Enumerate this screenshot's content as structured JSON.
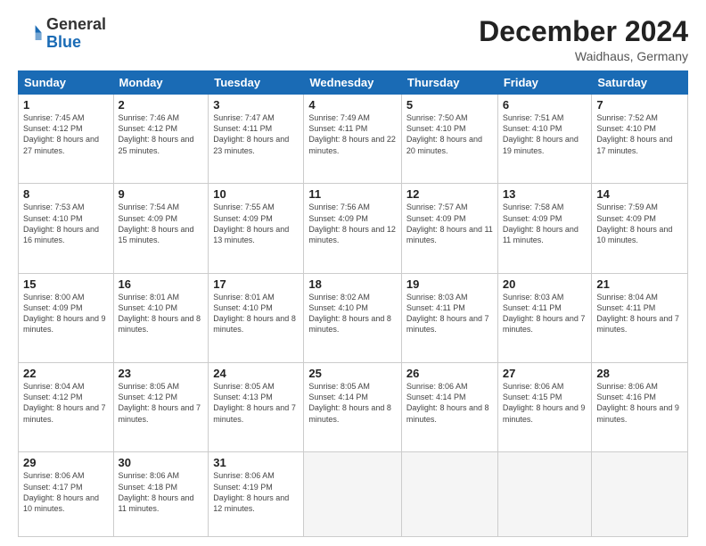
{
  "header": {
    "logo_text_general": "General",
    "logo_text_blue": "Blue",
    "month_title": "December 2024",
    "location": "Waidhaus, Germany"
  },
  "days_of_week": [
    "Sunday",
    "Monday",
    "Tuesday",
    "Wednesday",
    "Thursday",
    "Friday",
    "Saturday"
  ],
  "weeks": [
    [
      {
        "day": "1",
        "sunrise": "7:45 AM",
        "sunset": "4:12 PM",
        "daylight": "8 hours and 27 minutes."
      },
      {
        "day": "2",
        "sunrise": "7:46 AM",
        "sunset": "4:12 PM",
        "daylight": "8 hours and 25 minutes."
      },
      {
        "day": "3",
        "sunrise": "7:47 AM",
        "sunset": "4:11 PM",
        "daylight": "8 hours and 23 minutes."
      },
      {
        "day": "4",
        "sunrise": "7:49 AM",
        "sunset": "4:11 PM",
        "daylight": "8 hours and 22 minutes."
      },
      {
        "day": "5",
        "sunrise": "7:50 AM",
        "sunset": "4:10 PM",
        "daylight": "8 hours and 20 minutes."
      },
      {
        "day": "6",
        "sunrise": "7:51 AM",
        "sunset": "4:10 PM",
        "daylight": "8 hours and 19 minutes."
      },
      {
        "day": "7",
        "sunrise": "7:52 AM",
        "sunset": "4:10 PM",
        "daylight": "8 hours and 17 minutes."
      }
    ],
    [
      {
        "day": "8",
        "sunrise": "7:53 AM",
        "sunset": "4:10 PM",
        "daylight": "8 hours and 16 minutes."
      },
      {
        "day": "9",
        "sunrise": "7:54 AM",
        "sunset": "4:09 PM",
        "daylight": "8 hours and 15 minutes."
      },
      {
        "day": "10",
        "sunrise": "7:55 AM",
        "sunset": "4:09 PM",
        "daylight": "8 hours and 13 minutes."
      },
      {
        "day": "11",
        "sunrise": "7:56 AM",
        "sunset": "4:09 PM",
        "daylight": "8 hours and 12 minutes."
      },
      {
        "day": "12",
        "sunrise": "7:57 AM",
        "sunset": "4:09 PM",
        "daylight": "8 hours and 11 minutes."
      },
      {
        "day": "13",
        "sunrise": "7:58 AM",
        "sunset": "4:09 PM",
        "daylight": "8 hours and 11 minutes."
      },
      {
        "day": "14",
        "sunrise": "7:59 AM",
        "sunset": "4:09 PM",
        "daylight": "8 hours and 10 minutes."
      }
    ],
    [
      {
        "day": "15",
        "sunrise": "8:00 AM",
        "sunset": "4:09 PM",
        "daylight": "8 hours and 9 minutes."
      },
      {
        "day": "16",
        "sunrise": "8:01 AM",
        "sunset": "4:10 PM",
        "daylight": "8 hours and 8 minutes."
      },
      {
        "day": "17",
        "sunrise": "8:01 AM",
        "sunset": "4:10 PM",
        "daylight": "8 hours and 8 minutes."
      },
      {
        "day": "18",
        "sunrise": "8:02 AM",
        "sunset": "4:10 PM",
        "daylight": "8 hours and 8 minutes."
      },
      {
        "day": "19",
        "sunrise": "8:03 AM",
        "sunset": "4:11 PM",
        "daylight": "8 hours and 7 minutes."
      },
      {
        "day": "20",
        "sunrise": "8:03 AM",
        "sunset": "4:11 PM",
        "daylight": "8 hours and 7 minutes."
      },
      {
        "day": "21",
        "sunrise": "8:04 AM",
        "sunset": "4:11 PM",
        "daylight": "8 hours and 7 minutes."
      }
    ],
    [
      {
        "day": "22",
        "sunrise": "8:04 AM",
        "sunset": "4:12 PM",
        "daylight": "8 hours and 7 minutes."
      },
      {
        "day": "23",
        "sunrise": "8:05 AM",
        "sunset": "4:12 PM",
        "daylight": "8 hours and 7 minutes."
      },
      {
        "day": "24",
        "sunrise": "8:05 AM",
        "sunset": "4:13 PM",
        "daylight": "8 hours and 7 minutes."
      },
      {
        "day": "25",
        "sunrise": "8:05 AM",
        "sunset": "4:14 PM",
        "daylight": "8 hours and 8 minutes."
      },
      {
        "day": "26",
        "sunrise": "8:06 AM",
        "sunset": "4:14 PM",
        "daylight": "8 hours and 8 minutes."
      },
      {
        "day": "27",
        "sunrise": "8:06 AM",
        "sunset": "4:15 PM",
        "daylight": "8 hours and 9 minutes."
      },
      {
        "day": "28",
        "sunrise": "8:06 AM",
        "sunset": "4:16 PM",
        "daylight": "8 hours and 9 minutes."
      }
    ],
    [
      {
        "day": "29",
        "sunrise": "8:06 AM",
        "sunset": "4:17 PM",
        "daylight": "8 hours and 10 minutes."
      },
      {
        "day": "30",
        "sunrise": "8:06 AM",
        "sunset": "4:18 PM",
        "daylight": "8 hours and 11 minutes."
      },
      {
        "day": "31",
        "sunrise": "8:06 AM",
        "sunset": "4:19 PM",
        "daylight": "8 hours and 12 minutes."
      },
      null,
      null,
      null,
      null
    ]
  ]
}
